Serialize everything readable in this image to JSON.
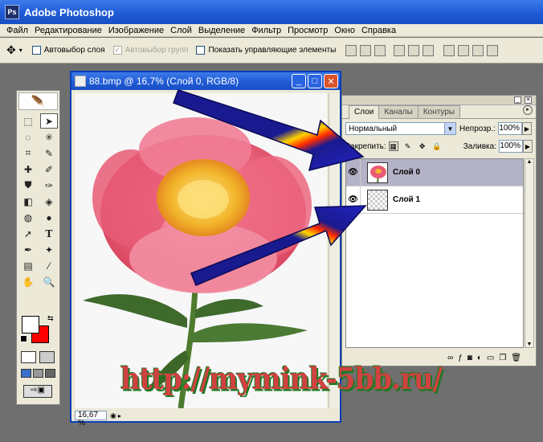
{
  "app": {
    "title": "Adobe Photoshop",
    "logo_text": "Ps"
  },
  "menu": [
    "Файл",
    "Редактирование",
    "Изображение",
    "Слой",
    "Выделение",
    "Фильтр",
    "Просмотр",
    "Окно",
    "Справка"
  ],
  "options_bar": {
    "auto_select_layer": "Автовыбор слоя",
    "auto_select_groups": "Автовыбор групп",
    "show_controls": "Показать управляющие элементы"
  },
  "document": {
    "title": "88.bmp @ 16,7% (Слой 0, RGB/8)",
    "zoom": "16,67 %",
    "minimize": "_",
    "maximize": "□",
    "close": "✕"
  },
  "layers_panel": {
    "tabs": [
      "Слои",
      "Каналы",
      "Контуры"
    ],
    "blend_mode": "Нормальный",
    "opacity_label": "Непрозр.:",
    "opacity_value": "100%",
    "lock_label": "Закрепить:",
    "fill_label": "Заливка:",
    "fill_value": "100%",
    "layers": [
      {
        "name": "Слой 0",
        "selected": true
      },
      {
        "name": "Слой 1",
        "selected": false
      }
    ]
  },
  "watermark": "http://mymink-5bb.ru/",
  "colors": {
    "titlebar": "#1f5bd6",
    "chrome": "#ece9d8",
    "foreground": "#ffffff",
    "background": "#ff0000",
    "arrow": "#1f1fa8",
    "selected_layer": "#b4b2c6"
  }
}
